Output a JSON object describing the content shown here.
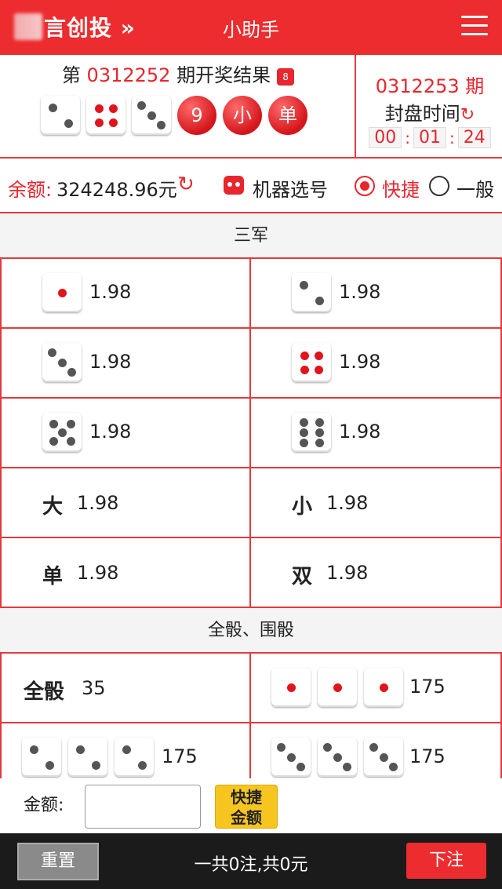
{
  "header": {
    "brand": "言创投 »",
    "title": "小助手"
  },
  "draw": {
    "prefix": "第 ",
    "issue": "0312252",
    "suffix": " 期开奖结果",
    "dice": [
      2,
      4,
      3
    ],
    "sum": "9",
    "size": "小",
    "parity": "单",
    "next_issue": "0312253 期",
    "close_label": "封盘时间",
    "timer": [
      "00",
      "01",
      "24"
    ]
  },
  "balance": {
    "label": "余额:",
    "value": "324248.96元",
    "machine_pick": "机器选号",
    "mode_quick": "快捷",
    "mode_general": "一般"
  },
  "sanjun": {
    "title": "三军",
    "rows": [
      {
        "left": {
          "dice": 1,
          "odds": "1.98"
        },
        "right": {
          "dice": 2,
          "odds": "1.98"
        }
      },
      {
        "left": {
          "dice": 3,
          "odds": "1.98"
        },
        "right": {
          "dice": 4,
          "odds": "1.98"
        }
      },
      {
        "left": {
          "dice": 5,
          "odds": "1.98"
        },
        "right": {
          "dice": 6,
          "odds": "1.98"
        }
      }
    ],
    "text_rows": [
      {
        "left": {
          "label": "大",
          "odds": "1.98"
        },
        "right": {
          "label": "小",
          "odds": "1.98"
        }
      },
      {
        "left": {
          "label": "单",
          "odds": "1.98"
        },
        "right": {
          "label": "双",
          "odds": "1.98"
        }
      }
    ]
  },
  "quanshai": {
    "title": "全骰、围骰",
    "all_label": "全骰",
    "all_odds": "35",
    "triples": [
      {
        "dice": 1,
        "odds": "175"
      },
      {
        "dice": 2,
        "odds": "175"
      },
      {
        "dice": 3,
        "odds": "175"
      }
    ]
  },
  "amount": {
    "label": "金额:",
    "quick_amount": "快捷\n金额"
  },
  "footer": {
    "reset": "重置",
    "total": "一共0注,共0元",
    "bet": "下注"
  }
}
